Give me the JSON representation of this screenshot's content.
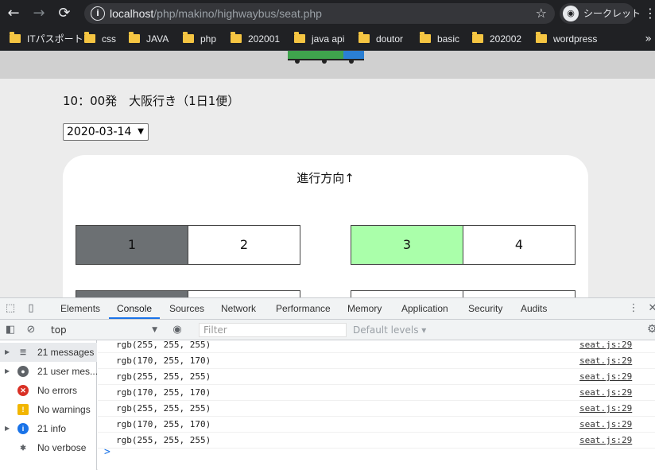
{
  "browser": {
    "url_host": "localhost",
    "url_path": "/php/makino/highwaybus/seat.php",
    "incognito_label": "シークレット"
  },
  "bookmarks": [
    "ITパスポート",
    "css",
    "JAVA",
    "php",
    "202001",
    "java api",
    "doutor",
    "basic",
    "202002",
    "wordpress"
  ],
  "page": {
    "heading": "10：00発　大阪行き（1日1便）",
    "date_value": "2020-03-14",
    "direction_label": "進行方向↑",
    "seats": [
      {
        "number": "1",
        "color": "#6c7073"
      },
      {
        "number": "2",
        "color": "#ffffff"
      },
      {
        "number": "3",
        "color": "#aaffaa"
      },
      {
        "number": "4",
        "color": "#ffffff"
      }
    ],
    "second_row_colors": [
      "#6c7073",
      "#ffffff",
      "#ffffff",
      "#ffffff"
    ]
  },
  "devtools": {
    "tabs": [
      "Elements",
      "Console",
      "Sources",
      "Network",
      "Performance",
      "Memory",
      "Application",
      "Security",
      "Audits"
    ],
    "active_tab": "Console",
    "context": "top",
    "filter_placeholder": "Filter",
    "levels_label": "Default levels ▾",
    "sidebar": [
      {
        "label": "21 messages",
        "icon": "list-icon"
      },
      {
        "label": "21 user mes...",
        "icon": "user-icon"
      },
      {
        "label": "No errors",
        "icon": "error-icon"
      },
      {
        "label": "No warnings",
        "icon": "warning-icon"
      },
      {
        "label": "21 info",
        "icon": "info-icon"
      },
      {
        "label": "No verbose",
        "icon": "bug-icon"
      }
    ],
    "log": [
      {
        "message": "rgb(255, 255, 255)",
        "source": "seat.js:29"
      },
      {
        "message": "rgb(170, 255, 170)",
        "source": "seat.js:29"
      },
      {
        "message": "rgb(255, 255, 255)",
        "source": "seat.js:29"
      },
      {
        "message": "rgb(170, 255, 170)",
        "source": "seat.js:29"
      },
      {
        "message": "rgb(255, 255, 255)",
        "source": "seat.js:29"
      },
      {
        "message": "rgb(170, 255, 170)",
        "source": "seat.js:29"
      },
      {
        "message": "rgb(255, 255, 255)",
        "source": "seat.js:29"
      }
    ],
    "prompt_symbol": ">"
  }
}
